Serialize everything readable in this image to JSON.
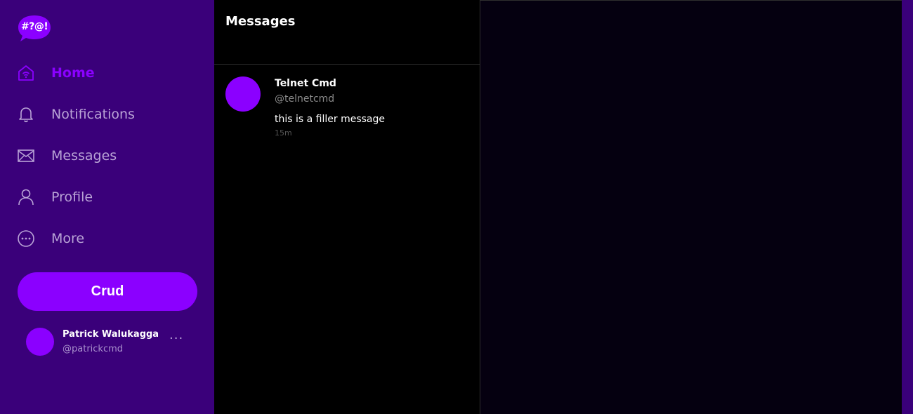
{
  "logo": {
    "text": "#?@!"
  },
  "sidebar": {
    "items": [
      {
        "label": "Home",
        "icon": "home-icon",
        "active": true
      },
      {
        "label": "Notifications",
        "icon": "bell-icon",
        "active": false
      },
      {
        "label": "Messages",
        "icon": "envelope-icon",
        "active": false
      },
      {
        "label": "Profile",
        "icon": "user-icon",
        "active": false
      },
      {
        "label": "More",
        "icon": "more-circle-icon",
        "active": false
      }
    ],
    "primary_button": "Crud"
  },
  "user": {
    "name": "Patrick Walukagga",
    "handle": "@patrickcmd",
    "more": "···"
  },
  "messages": {
    "title": "Messages",
    "items": [
      {
        "name": "Telnet Cmd",
        "handle": "@telnetcmd",
        "text": "this is a filler message",
        "time": "15m"
      }
    ]
  },
  "colors": {
    "sidebar_bg": "#3a007a",
    "accent": "#8b00ff",
    "nav_text": "#b9a3d6"
  }
}
